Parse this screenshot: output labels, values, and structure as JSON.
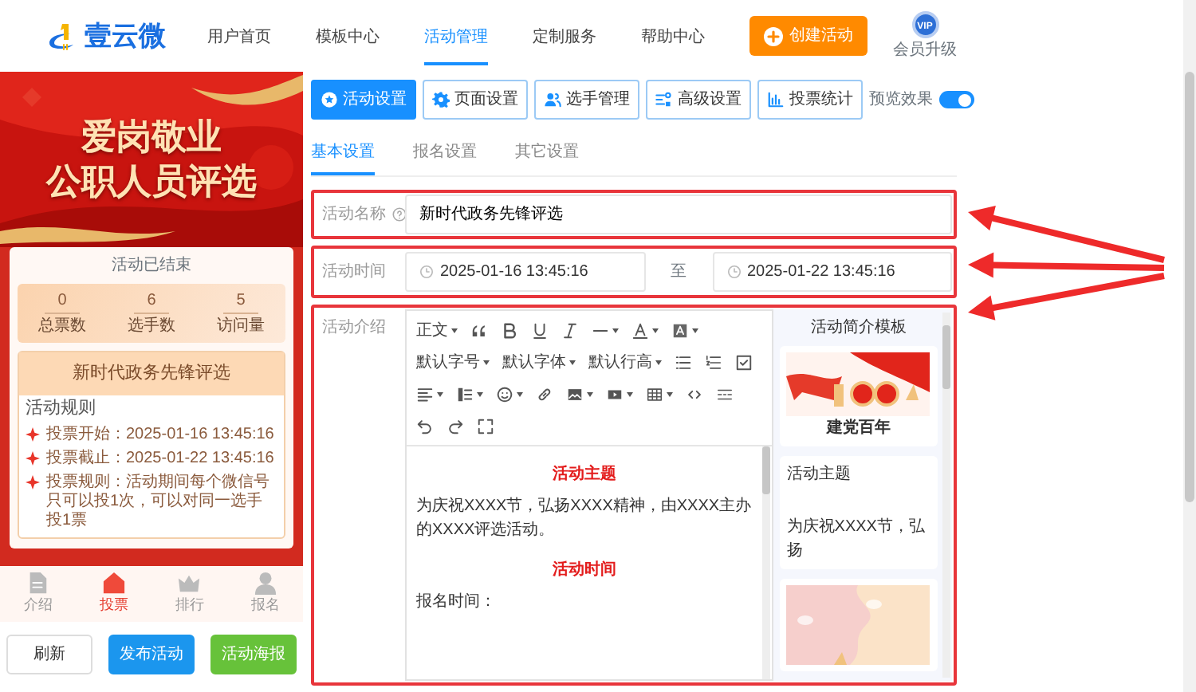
{
  "header": {
    "logo": "壹云微",
    "nav": [
      {
        "label": "用户首页",
        "selected": false
      },
      {
        "label": "模板中心",
        "selected": false
      },
      {
        "label": "活动管理",
        "selected": true
      },
      {
        "label": "定制服务",
        "selected": false
      },
      {
        "label": "帮助中心",
        "selected": false
      }
    ],
    "create_button": "创建活动",
    "vip": {
      "badge": "VIP",
      "label": "会员升级"
    }
  },
  "preview": {
    "banner": {
      "kind": "picture",
      "title": [
        "爱岗敬业",
        "公职人员评选"
      ]
    },
    "status": "活动已结束",
    "stats": [
      {
        "value": "0",
        "label": "总票数"
      },
      {
        "value": "6",
        "label": "选手数"
      },
      {
        "value": "5",
        "label": "访问量"
      }
    ],
    "card_title": "新时代政务先锋评选",
    "rules_title": "活动规则",
    "rules": [
      {
        "text": "投票开始：2025-01-16 13:45:16"
      },
      {
        "text": "投票截止：2025-01-22 13:45:16"
      },
      {
        "text": "投票规则：活动期间每个微信号只可以投1次，可以对同一选手投1票"
      }
    ],
    "tabs": [
      {
        "label": "介绍",
        "selected": false
      },
      {
        "label": "投票",
        "selected": true
      },
      {
        "label": "排行",
        "selected": false
      },
      {
        "label": "报名",
        "selected": false
      }
    ],
    "buttons": [
      {
        "label": "刷新",
        "kind": "default"
      },
      {
        "label": "发布活动",
        "kind": "primary"
      },
      {
        "label": "活动海报",
        "kind": "success"
      }
    ]
  },
  "toolbar": [
    {
      "label": "活动设置",
      "selected": true
    },
    {
      "label": "页面设置",
      "selected": false
    },
    {
      "label": "选手管理",
      "selected": false
    },
    {
      "label": "高级设置",
      "selected": false
    },
    {
      "label": "投票统计",
      "selected": false
    }
  ],
  "preview_toggle": {
    "label": "预览效果",
    "on": true
  },
  "subtabs": [
    {
      "label": "基本设置",
      "selected": true
    },
    {
      "label": "报名设置",
      "selected": false
    },
    {
      "label": "其它设置",
      "selected": false
    }
  ],
  "form": {
    "name": {
      "label": "活动名称",
      "value": "新时代政务先锋评选"
    },
    "time": {
      "label": "活动时间",
      "start": "2025-01-16 13:45:16",
      "separator": "至",
      "end": "2025-01-22 13:45:16"
    },
    "intro": {
      "label": "活动介绍",
      "editor_toolbar": [
        {
          "kind": "select",
          "label": "正文"
        },
        {
          "kind": "icon",
          "dropdown": false
        },
        {
          "kind": "icon",
          "dropdown": false
        },
        {
          "kind": "icon",
          "dropdown": false
        },
        {
          "kind": "icon",
          "dropdown": false
        },
        {
          "kind": "icon",
          "dropdown": true
        },
        {
          "kind": "icon",
          "dropdown": true
        },
        {
          "kind": "icon",
          "dropdown": true
        },
        {
          "kind": "select",
          "label": "默认字号"
        },
        {
          "kind": "select",
          "label": "默认字体"
        },
        {
          "kind": "select",
          "label": "默认行高"
        },
        {
          "kind": "icon",
          "dropdown": false
        },
        {
          "kind": "icon",
          "dropdown": false
        },
        {
          "kind": "icon",
          "dropdown": false
        },
        {
          "kind": "icon",
          "dropdown": true
        },
        {
          "kind": "icon",
          "dropdown": true
        },
        {
          "kind": "icon",
          "dropdown": true
        },
        {
          "kind": "icon",
          "dropdown": false
        },
        {
          "kind": "icon",
          "dropdown": true
        },
        {
          "kind": "icon",
          "dropdown": true
        },
        {
          "kind": "icon",
          "dropdown": true
        },
        {
          "kind": "icon",
          "dropdown": false
        },
        {
          "kind": "icon",
          "dropdown": false
        },
        {
          "kind": "icon",
          "dropdown": false
        },
        {
          "kind": "icon",
          "dropdown": false
        },
        {
          "kind": "icon",
          "dropdown": false
        }
      ],
      "content": [
        {
          "kind": "heading",
          "text": "活动主题"
        },
        {
          "kind": "paragraph",
          "text": "为庆祝XXXX节，弘扬XXXX精神，由XXXX主办的XXXX评选活动。"
        },
        {
          "kind": "heading",
          "text": "活动时间"
        },
        {
          "kind": "paragraph",
          "text": "报名时间："
        }
      ],
      "templates": {
        "title": "活动简介模板",
        "items": [
          {
            "kind": "picture",
            "caption": "建党百年"
          },
          {
            "kind": "text",
            "heading": "活动主题",
            "text": "为庆祝XXXX节，弘扬"
          },
          {
            "kind": "picture"
          }
        ]
      }
    }
  }
}
